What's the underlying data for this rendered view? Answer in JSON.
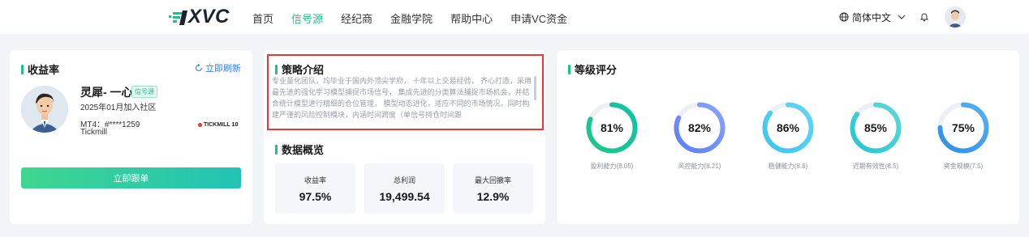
{
  "header": {
    "logo_text": "XVC",
    "nav": [
      "首页",
      "信号源",
      "经纪商",
      "金融学院",
      "帮助中心",
      "申请VC资金"
    ],
    "active_nav": 1,
    "language": "简体中文"
  },
  "returns_card": {
    "title": "收益率",
    "refresh_label": "立即刷新",
    "trader_name": "灵犀- 一心",
    "badge": "信号源",
    "join_date": "2025年01月加入社区",
    "mt4": "MT4：#****1259",
    "broker": "Tickmill",
    "broker_logo": "TICKMILL",
    "broker_logo_tag": "10",
    "follow_button": "立即跟单"
  },
  "strategy_card": {
    "title": "策略介绍",
    "text": "专业量化团队，均毕业于国内外顶尖学府， 十年以上交易经验， 齐心打造，采用最先进的强化学习模型捕捉市场信号， 集成先进的分类算法捕捉市场机会，并结合统计模型进行精细的仓位管理， 模型动态进化，适应不同的市场情况。同时构建严谨的风险控制模块，内涵时间跨度（单信号持仓时间跟"
  },
  "overview": {
    "title": "数据概览",
    "stats": [
      {
        "label": "收益率",
        "value": "97.5%"
      },
      {
        "label": "总利润",
        "value": "19,499.54"
      },
      {
        "label": "最大回撤率",
        "value": "12.9%"
      }
    ]
  },
  "rating_card": {
    "title": "等级评分",
    "rings": [
      {
        "percent": 81,
        "text": "81%",
        "label": "盈利能力(8.05)",
        "color_start": "#19c98a",
        "color_end": "#10c2a6"
      },
      {
        "percent": 82,
        "text": "82%",
        "label": "风控能力(8.21)",
        "color_start": "#5b7ff7",
        "color_end": "#8aa3fb"
      },
      {
        "percent": 86,
        "text": "86%",
        "label": "稳健能力(8.6)",
        "color_start": "#3ac7f0",
        "color_end": "#63d5f5"
      },
      {
        "percent": 85,
        "text": "85%",
        "label": "近期有效性(8.5)",
        "color_start": "#24c5d0",
        "color_end": "#5fdad8"
      },
      {
        "percent": 75,
        "text": "75%",
        "label": "资金规模(7.5)",
        "color_start": "#2f8fe8",
        "color_end": "#56b0f2"
      }
    ]
  }
}
